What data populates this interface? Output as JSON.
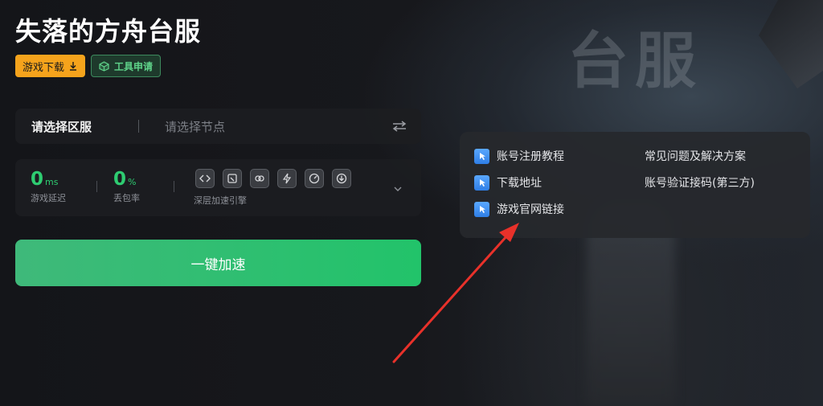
{
  "background": {
    "watermark_title": "台服"
  },
  "header": {
    "title": "失落的方舟台服",
    "download_label": "游戏下载",
    "tool_label": "工具申请"
  },
  "region": {
    "region_placeholder": "请选择区服",
    "node_placeholder": "请选择节点"
  },
  "stats": {
    "latency_value": "0",
    "latency_unit": "ms",
    "latency_label": "游戏延迟",
    "loss_value": "0",
    "loss_unit": "%",
    "loss_label": "丢包率",
    "engine_label": "深层加速引擎",
    "engine_icons": [
      "link-code-icon",
      "screen-icon",
      "chain-icon",
      "lightning-icon",
      "speedometer-icon",
      "download-circle-icon"
    ]
  },
  "boost_button": {
    "label": "一键加速"
  },
  "links": {
    "col1": [
      "账号注册教程",
      "下载地址",
      "游戏官网链接"
    ],
    "col2": [
      "常见问题及解决方案",
      "账号验证接码(第三方)"
    ]
  },
  "colors": {
    "accent_green": "#2ecc71",
    "download_orange": "#f5a31c",
    "arrow_red": "#e8312a"
  }
}
